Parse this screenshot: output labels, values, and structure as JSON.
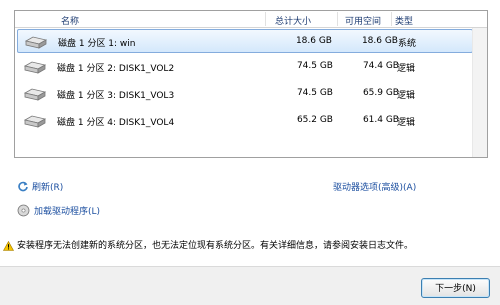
{
  "table": {
    "columns": {
      "name": "名称",
      "total": "总计大小",
      "free": "可用空间",
      "type": "类型"
    },
    "rows": [
      {
        "name": "磁盘 1 分区 1: win",
        "total": "18.6 GB",
        "free": "18.6 GB",
        "type": "系统"
      },
      {
        "name": "磁盘 1 分区 2: DISK1_VOL2",
        "total": "74.5 GB",
        "free": "74.4 GB",
        "type": "逻辑"
      },
      {
        "name": "磁盘 1 分区 3: DISK1_VOL3",
        "total": "74.5 GB",
        "free": "65.9 GB",
        "type": "逻辑"
      },
      {
        "name": "磁盘 1 分区 4: DISK1_VOL4",
        "total": "65.2 GB",
        "free": "61.4 GB",
        "type": "逻辑"
      }
    ]
  },
  "actions": {
    "refresh": "刷新",
    "refresh_key": "(R)",
    "drive_options": "驱动器选项(高级)",
    "drive_options_key": "(A)",
    "load_driver": "加载驱动程序",
    "load_driver_key": "(L)"
  },
  "warning": "安装程序无法创建新的系统分区，也无法定位现有系统分区。有关详细信息，请参阅安装日志文件。",
  "footer": {
    "next": "下一步",
    "next_key": "(N)"
  },
  "colors": {
    "link": "#1c4fa0",
    "selection": "#d4e8fc",
    "warning": "#f5c400"
  }
}
